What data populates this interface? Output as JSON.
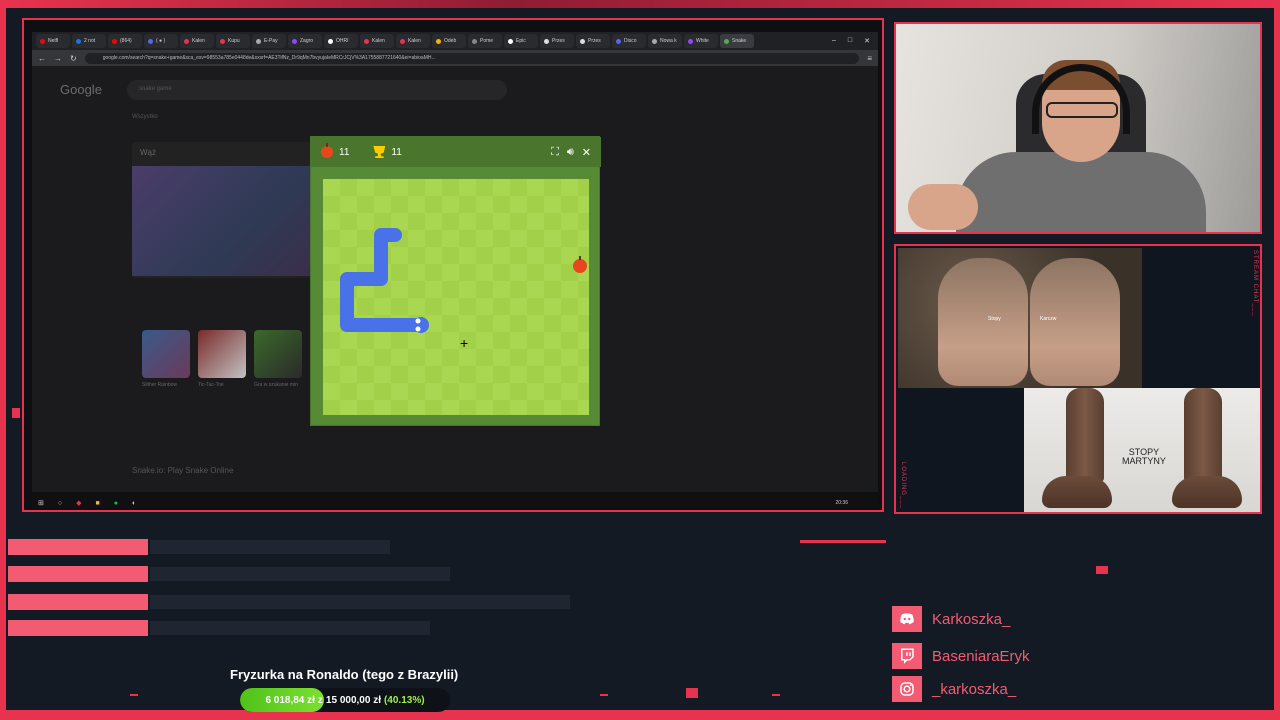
{
  "browser": {
    "tabs": [
      "Netfl",
      "2 not",
      "(864)",
      "( ● )",
      "Kalen",
      "Kupu",
      "E-Pay",
      "Zagro",
      "OHRI",
      "Kalen",
      "Kalen",
      "Odeb",
      "Pome",
      "Epic",
      "Przes",
      "Przes",
      "Disco",
      "Nowa k",
      "White",
      "Snake"
    ],
    "url": "google.com/search?q=snake+game&sca_esv=98553a785e0448de&sxsrf=AE3TifNz_Dr9qMn7bvyujaIeMRCrJCjV%3A1755887721640&ei=abioaMH..."
  },
  "google": {
    "logo": "Google",
    "query": "snake game",
    "tab_all": "Wszystko",
    "card_title": "Wąż",
    "thumbs": [
      "Slither Rainbow",
      "Tic-Tac-Toe",
      "Gra w szukanie min"
    ],
    "footer": "Snake.io: Play Snake Online"
  },
  "game": {
    "apples": "11",
    "best": "11"
  },
  "feet": {
    "label_left": "Stopy",
    "label_right": "Karczw",
    "caption_line1": "STOPY",
    "caption_line2": "MARTYNY"
  },
  "side_texts": {
    "right": "STREAM CHAT___",
    "left": "LOADING___"
  },
  "taskbar": {
    "clock": "20:36"
  },
  "socials": [
    {
      "name": "Karkoszka_",
      "icon": "discord-icon"
    },
    {
      "name": "BaseniaraEryk",
      "icon": "twitch-icon"
    },
    {
      "name": "_karkoszka_",
      "icon": "instagram-icon"
    }
  ],
  "goal": {
    "title": "Fryzurka na Ronaldo (tego z Brazylii)",
    "current": "6 018,84 zł",
    "separator": "z",
    "target": "15 000,00 zł",
    "percent": "(40.13%)",
    "progress": 0.4013
  },
  "colors": {
    "accent": "#e8334f",
    "goal_fill": "#4fc21a",
    "snake": "#4a72e8",
    "apple": "#e7471d"
  }
}
